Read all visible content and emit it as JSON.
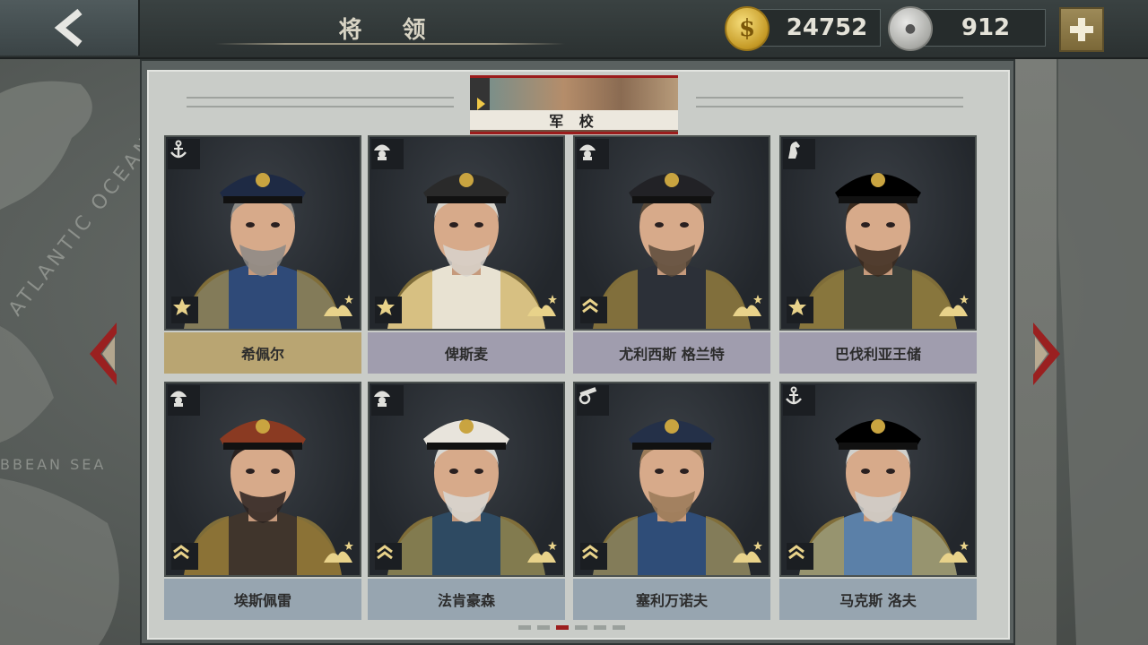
{
  "header": {
    "title": "将 领",
    "gold_amount": "24752",
    "silver_amount": "912",
    "gold_symbol": "$",
    "silver_symbol": "●"
  },
  "tab": {
    "label": "军 校"
  },
  "generals": [
    {
      "name": "希佩尔",
      "branch": "anchor-icon",
      "highlight": "gold"
    },
    {
      "name": "俾斯麦",
      "branch": "infantry-helmet-icon",
      "highlight": "lavender"
    },
    {
      "name": "尤利西斯 格兰特",
      "branch": "infantry-helmet-icon",
      "highlight": "lavender"
    },
    {
      "name": "巴伐利亚王储",
      "branch": "cavalry-horse-icon",
      "highlight": "lavender"
    },
    {
      "name": "埃斯佩雷",
      "branch": "infantry-helmet-icon",
      "highlight": "steel"
    },
    {
      "name": "法肯豪森",
      "branch": "infantry-helmet-icon",
      "highlight": "steel"
    },
    {
      "name": "塞利万诺夫",
      "branch": "artillery-cannon-icon",
      "highlight": "steel"
    },
    {
      "name": "马克斯 洛夫",
      "branch": "anchor-icon",
      "highlight": "steel"
    }
  ],
  "pagination": {
    "total": 6,
    "current": 3
  },
  "colors": {
    "accent_red": "#9c1e1e",
    "gold_name_bg": "#b9a572",
    "lavender_name_bg": "#a09dae",
    "steel_name_bg": "#97a5b0"
  }
}
